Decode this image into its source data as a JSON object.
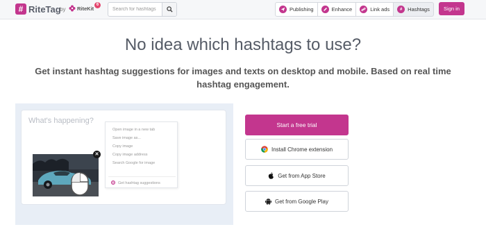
{
  "header": {
    "logo_text": "RiteTag",
    "by_text": "by",
    "ritekit_text": "RiteKit",
    "badge_count": "6",
    "search": {
      "placeholder": "Search for hashtags"
    },
    "nav": [
      {
        "label": "Publishing",
        "icon": "paper-plane-icon"
      },
      {
        "label": "Enhance",
        "icon": "pencil-icon"
      },
      {
        "label": "Link ads",
        "icon": "link-icon"
      },
      {
        "label": "Hashtags",
        "icon": "hashtag-icon"
      }
    ],
    "signin_label": "Sign in"
  },
  "hero": {
    "headline": "No idea which hashtags to use?",
    "subline": "Get instant hashtag suggestions for images and texts on desktop and mobile. Based on real time hashtag engagement."
  },
  "demo": {
    "placeholder": "What's happening?",
    "context_menu": [
      "Open image in a new tab",
      "Save image as...",
      "Copy image",
      "Copy image address",
      "Search Google for image"
    ],
    "context_menu_hashtag": "Get hashtag suggestions"
  },
  "cta": {
    "trial_label": "Start a free trial",
    "chrome_label": "Install Chrome extension",
    "appstore_label": "Get from App Store",
    "googleplay_label": "Get from Google Play"
  },
  "colors": {
    "brand": "#c3368e"
  }
}
